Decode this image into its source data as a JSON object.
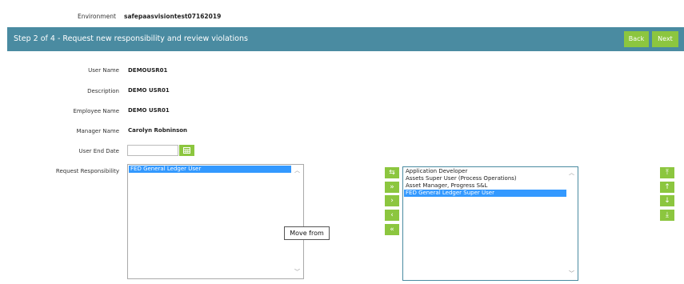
{
  "environment": {
    "label": "Environment",
    "value": "safepaasvisiontest07162019"
  },
  "step": {
    "title": "Step 2 of 4 - Request new responsibility and review violations",
    "back_label": "Back",
    "next_label": "Next"
  },
  "form": {
    "user_name": {
      "label": "User Name",
      "value": "DEMOUSR01"
    },
    "description": {
      "label": "Description",
      "value": "DEMO USR01"
    },
    "employee_name": {
      "label": "Employee Name",
      "value": "DEMO USR01"
    },
    "manager_name": {
      "label": "Manager Name",
      "value": "Carolyn Robninson"
    },
    "user_end_date": {
      "label": "User End Date",
      "value": ""
    },
    "request_responsibility": {
      "label": "Request Responsibility"
    }
  },
  "left_list": {
    "items": [
      "FED General Ledger User"
    ],
    "selected_index": 0
  },
  "right_list": {
    "items": [
      "Application Developer",
      "Assets Super User (Process Operations)",
      "Asset Manager, Progress S&L",
      "FED General Ledger Super User"
    ],
    "selected_index": 3
  },
  "move_buttons": [
    {
      "name": "move-selected-icon-button",
      "glyph": "⇆"
    },
    {
      "name": "move-all-right-button",
      "glyph": "»"
    },
    {
      "name": "move-right-button",
      "glyph": "›"
    },
    {
      "name": "move-left-button",
      "glyph": "‹"
    },
    {
      "name": "move-all-left-button",
      "glyph": "«"
    }
  ],
  "order_buttons": [
    {
      "name": "move-to-top-button",
      "glyph": "⤒"
    },
    {
      "name": "move-up-button",
      "glyph": "↑"
    },
    {
      "name": "move-down-button",
      "glyph": "↓"
    },
    {
      "name": "move-to-bottom-button",
      "glyph": "⤓"
    }
  ],
  "tooltip": {
    "text": "Move from"
  },
  "colors": {
    "header_bar": "#4a8ba1",
    "button_green": "#8cc63f",
    "selection_blue": "#3399ff"
  }
}
